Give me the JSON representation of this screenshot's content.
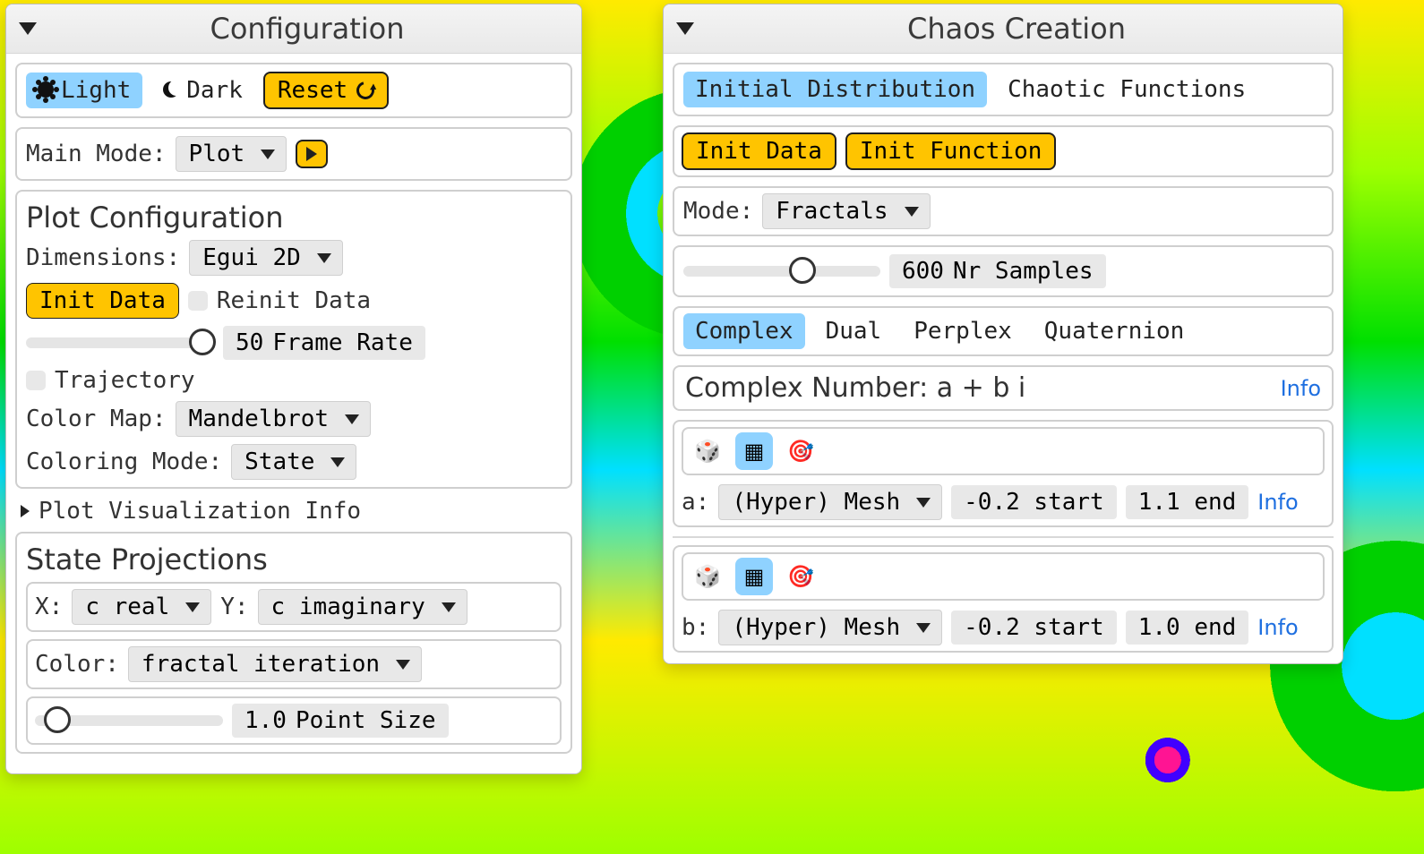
{
  "config": {
    "title": "Configuration",
    "theme": {
      "light": "Light",
      "dark": "Dark"
    },
    "reset": "Reset",
    "main_mode_label": "Main Mode:",
    "main_mode_value": "Plot",
    "plot_cfg": {
      "title": "Plot Configuration",
      "dimensions_label": "Dimensions:",
      "dimensions_value": "Egui 2D",
      "init_data": "Init Data",
      "reinit_data": "Reinit Data",
      "frame_rate_value": "50",
      "frame_rate_label": "Frame Rate",
      "trajectory": "Trajectory",
      "color_map_label": "Color Map:",
      "color_map_value": "Mandelbrot",
      "coloring_mode_label": "Coloring Mode:",
      "coloring_mode_value": "State"
    },
    "plot_vis_info": "Plot Visualization Info",
    "state_proj": {
      "title": "State Projections",
      "x_label": "X:",
      "x_value": "c real",
      "y_label": "Y:",
      "y_value": "c imaginary",
      "color_label": "Color:",
      "color_value": "fractal iteration",
      "point_size_value": "1.0",
      "point_size_label": "Point Size"
    }
  },
  "chaos": {
    "title": "Chaos Creation",
    "tabs": {
      "initial_distribution": "Initial Distribution",
      "chaotic_functions": "Chaotic Functions"
    },
    "init_data": "Init Data",
    "init_function": "Init Function",
    "mode_label": "Mode:",
    "mode_value": "Fractals",
    "samples_value": "600",
    "samples_label": "Nr Samples",
    "number_types": {
      "complex": "Complex",
      "dual": "Dual",
      "perplex": "Perplex",
      "quaternion": "Quaternion"
    },
    "complex_header": "Complex Number: a + b i",
    "info": "Info",
    "params": {
      "a": {
        "name": "a:",
        "dist": "(Hyper) Mesh",
        "start": "-0.2 start",
        "end": "1.1 end"
      },
      "b": {
        "name": "b:",
        "dist": "(Hyper) Mesh",
        "start": "-0.2 start",
        "end": "1.0 end"
      }
    },
    "icons": {
      "dice": "🎲",
      "grid": "▦",
      "target": "🎯"
    }
  }
}
